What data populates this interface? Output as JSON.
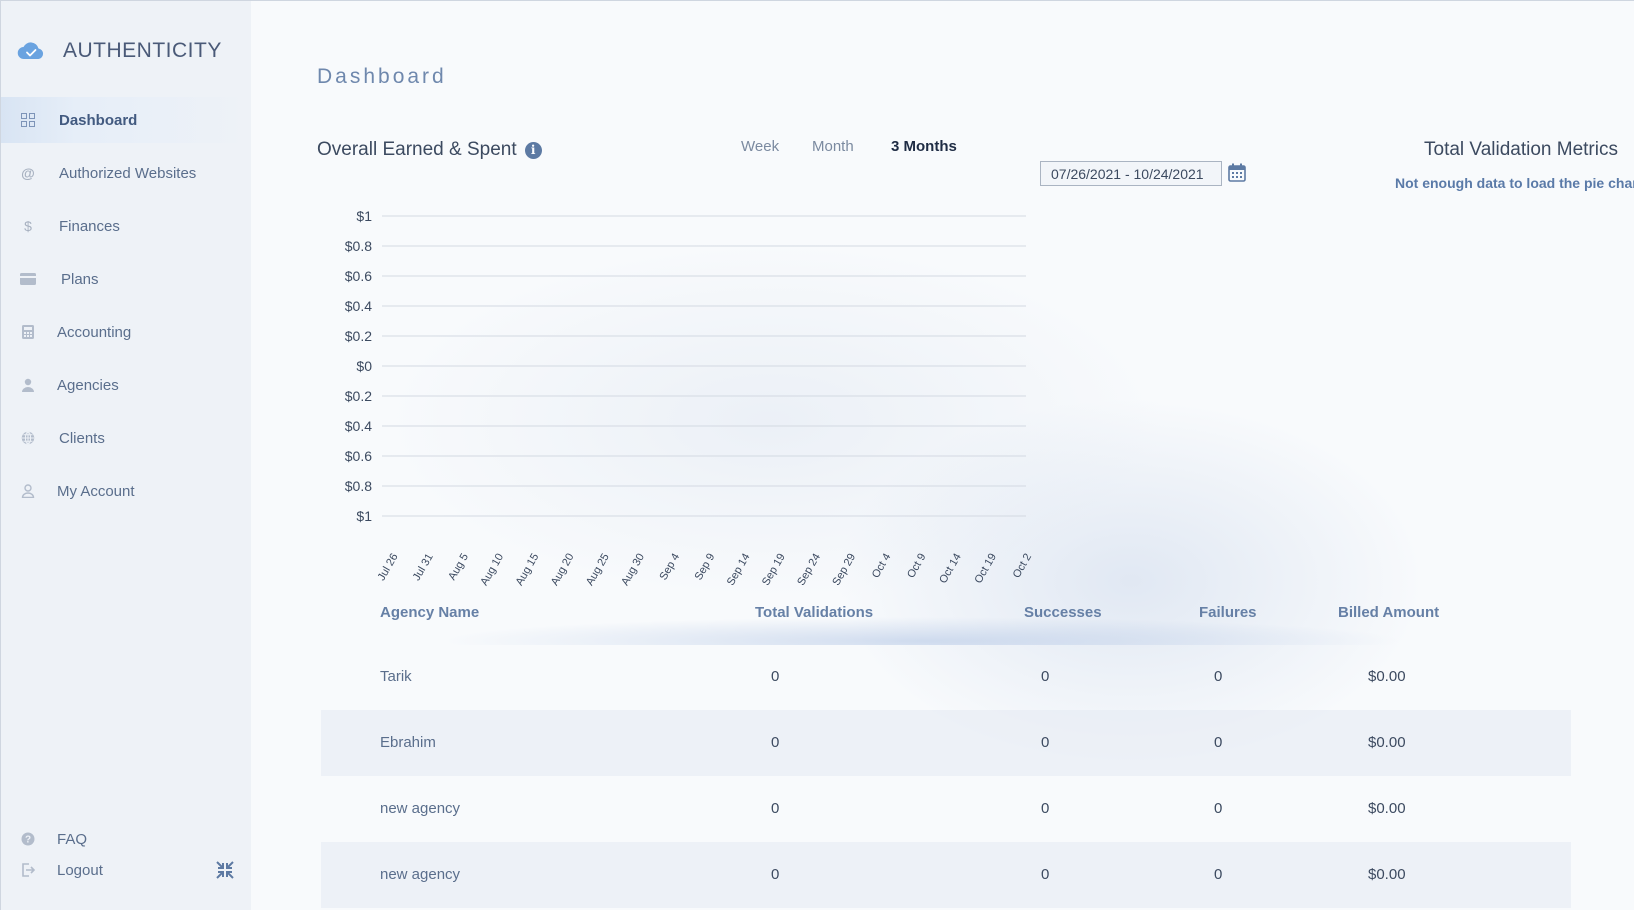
{
  "app": {
    "brand": "AUTHENTICITY"
  },
  "sidebar": {
    "items": [
      {
        "label": "Dashboard",
        "icon": "grid-icon",
        "active": true
      },
      {
        "label": "Authorized Websites",
        "icon": "at-icon"
      },
      {
        "label": "Finances",
        "icon": "dollar-icon"
      },
      {
        "label": "Plans",
        "icon": "card-icon"
      },
      {
        "label": "Accounting",
        "icon": "calculator-icon"
      },
      {
        "label": "Agencies",
        "icon": "user-icon"
      },
      {
        "label": "Clients",
        "icon": "globe-icon"
      },
      {
        "label": "My Account",
        "icon": "user-outline-icon"
      }
    ],
    "faq": "FAQ",
    "logout": "Logout"
  },
  "main": {
    "page_title": "Dashboard",
    "chart_title": "Overall Earned & Spent",
    "range_tabs": [
      "Week",
      "Month",
      "3 Months"
    ],
    "active_range": "3 Months",
    "date_range": "07/26/2021 - 10/24/2021",
    "pie_title": "Total Validation Metrics",
    "pie_message": "Not enough data to load the pie chart!"
  },
  "chart_data": {
    "type": "line",
    "title": "Overall Earned & Spent",
    "xlabel": "",
    "ylabel": "",
    "y_ticks": [
      "$1",
      "$0.8",
      "$0.6",
      "$0.4",
      "$0.2",
      "$0",
      "$0.2",
      "$0.4",
      "$0.6",
      "$0.8",
      "$1"
    ],
    "ylim": [
      -1,
      1
    ],
    "categories": [
      "Jul 26",
      "Jul 31",
      "Aug 5",
      "Aug 10",
      "Aug 15",
      "Aug 20",
      "Aug 25",
      "Aug 30",
      "Sep 4",
      "Sep 9",
      "Sep 14",
      "Sep 19",
      "Sep 24",
      "Sep 29",
      "Oct 4",
      "Oct 9",
      "Oct 14",
      "Oct 19",
      "Oct 2"
    ],
    "series": [],
    "grid": true
  },
  "table": {
    "headers": [
      "Agency Name",
      "Total Validations",
      "Successes",
      "Failures",
      "Billed Amount"
    ],
    "rows": [
      [
        "Tarik",
        "0",
        "0",
        "0",
        "$0.00"
      ],
      [
        "Ebrahim",
        "0",
        "0",
        "0",
        "$0.00"
      ],
      [
        "new agency",
        "0",
        "0",
        "0",
        "$0.00"
      ],
      [
        "new agency",
        "0",
        "0",
        "0",
        "$0.00"
      ]
    ]
  },
  "colors": {
    "accent": "#5d7aa3",
    "sidebar_bg": "#eef2f7",
    "brand_icon": "#6aa3e0"
  }
}
